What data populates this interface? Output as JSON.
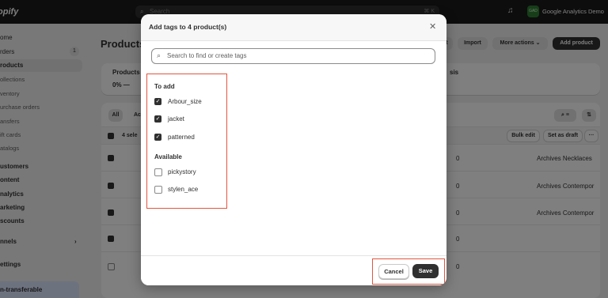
{
  "topbar": {
    "logo": "opify",
    "search_placeholder": "Search",
    "search_shortcut": "⌘ K",
    "store_initials": "GAD",
    "store_name": "Google Analytics Demo"
  },
  "sidebar": {
    "items": [
      {
        "label": "ome"
      },
      {
        "label": "rders",
        "badge": "1"
      },
      {
        "label": "roducts",
        "active": true
      },
      {
        "label": "ollections"
      },
      {
        "label": "ventory"
      },
      {
        "label": "urchase orders"
      },
      {
        "label": "ansfers"
      },
      {
        "label": "ift cards"
      },
      {
        "label": "atalogs"
      },
      {
        "label": "ustomers"
      },
      {
        "label": "ontent"
      },
      {
        "label": "nalytics"
      },
      {
        "label": "arketing"
      },
      {
        "label": "scounts"
      },
      {
        "label": "nnels"
      },
      {
        "label": "ettings"
      }
    ],
    "footer": "n-transferable"
  },
  "page": {
    "title": "Products",
    "actions": {
      "export": "rt",
      "import": "Import",
      "more": "More actions ⌄",
      "add": "Add product"
    },
    "stats": {
      "label": "Products",
      "value": "0% —",
      "right_label": "sis"
    },
    "filters": {
      "all": "All",
      "ac": "Ac"
    },
    "selected_count": "4 sele",
    "bulk_edit": "Bulk edit",
    "set_draft": "Set as draft",
    "more_dots": "···",
    "rows": [
      {
        "inv": "0",
        "vendor": "Archives Necklaces",
        "checked": true
      },
      {
        "inv": "0",
        "vendor": "Archives Contempor",
        "checked": true
      },
      {
        "inv": "0",
        "vendor": "Archives Contempor",
        "checked": true
      },
      {
        "inv": "0",
        "vendor": "",
        "checked": true
      },
      {
        "inv": "0",
        "vendor": "",
        "checked": false
      }
    ]
  },
  "modal": {
    "title": "Add tags to 4 product(s)",
    "search_placeholder": "Search to find or create tags",
    "to_add_heading": "To add",
    "to_add": [
      {
        "label": "Arbour_size",
        "checked": true
      },
      {
        "label": "jacket",
        "checked": true
      },
      {
        "label": "patterned",
        "checked": true
      }
    ],
    "available_heading": "Available",
    "available": [
      {
        "label": "pickystory",
        "checked": false
      },
      {
        "label": "stylen_ace",
        "checked": false
      }
    ],
    "cancel_label": "Cancel",
    "save_label": "Save"
  },
  "colors": {
    "highlight": "#e2553e",
    "primary": "#303030",
    "topbar": "#1a1a1a"
  }
}
